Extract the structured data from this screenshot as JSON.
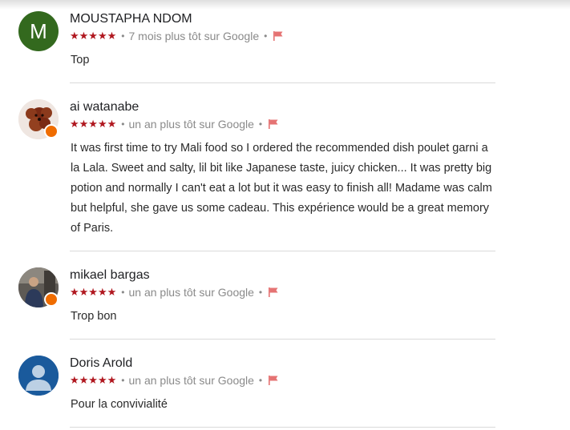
{
  "colors": {
    "star": "#b0171f",
    "flag": "#e57373",
    "meta_text": "#8a8a8a",
    "divider": "#dadada",
    "avatar_m_bg": "#33691e",
    "avatar_default_bg": "#1a5a9c",
    "local_guide_badge": "#ef6c00"
  },
  "reviews": [
    {
      "author": "MOUSTAPHA NDOM",
      "avatar": {
        "type": "letter",
        "letter": "M"
      },
      "rating": 5,
      "stars": "★★★★★",
      "separator": "•",
      "timestamp": "7 mois plus tôt sur Google",
      "text": "Top",
      "flag_icon": "flag-icon"
    },
    {
      "author": "ai watanabe",
      "avatar": {
        "type": "photo",
        "subject": "dog-photo",
        "local_guide": true
      },
      "rating": 5,
      "stars": "★★★★★",
      "separator": "•",
      "timestamp": "un an plus tôt sur Google",
      "text": "It was first time to try Mali food so I ordered the recommended dish poulet garni a la Lala. Sweet and salty, lil bit like Japanese taste, juicy chicken... It was pretty big potion and normally I can't eat a lot but it was easy to finish all! Madame was calm but helpful, she gave us some cadeau. This expérience would be a great memory of Paris.",
      "flag_icon": "flag-icon"
    },
    {
      "author": "mikael bargas",
      "avatar": {
        "type": "photo",
        "subject": "person-photo",
        "local_guide": true
      },
      "rating": 5,
      "stars": "★★★★★",
      "separator": "•",
      "timestamp": "un an plus tôt sur Google",
      "text": "Trop bon",
      "flag_icon": "flag-icon"
    },
    {
      "author": "Doris Arold",
      "avatar": {
        "type": "default",
        "subject": "default-user-icon"
      },
      "rating": 5,
      "stars": "★★★★★",
      "separator": "•",
      "timestamp": "un an plus tôt sur Google",
      "text": "Pour la convivialité",
      "flag_icon": "flag-icon"
    }
  ]
}
